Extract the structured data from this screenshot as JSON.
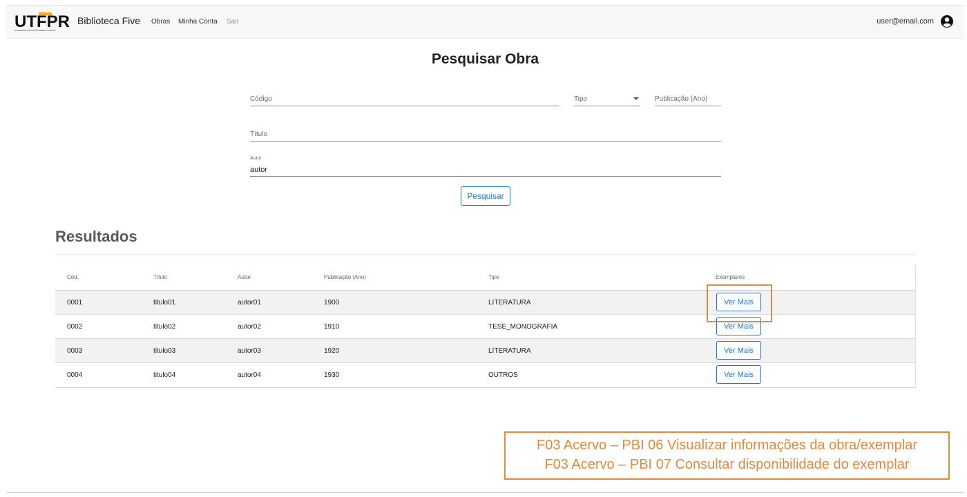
{
  "navbar": {
    "logo_text": "UTFPR",
    "logo_subtitle": "UNIVERSIDADE TECNOLÓGICA FEDERAL DO PARANÁ",
    "brand": "Biblioteca Five",
    "links": [
      {
        "label": "Obras"
      },
      {
        "label": "Minha Conta"
      },
      {
        "label": "Sair"
      }
    ],
    "user_email": "user@email.com",
    "user_icon": "account-circle-icon"
  },
  "search": {
    "title": "Pesquisar Obra",
    "fields": {
      "codigo": {
        "label": "Código",
        "value": ""
      },
      "tipo": {
        "label": "Tipo",
        "value": ""
      },
      "publicacao": {
        "label": "Publicação (Ano)",
        "value": ""
      },
      "titulo": {
        "label": "Título",
        "value": ""
      },
      "autor": {
        "label": "Autor",
        "value": "autor"
      }
    },
    "submit_label": "Pesquisar"
  },
  "results": {
    "title": "Resultados",
    "columns": [
      "Cód.",
      "Título",
      "Autor",
      "Publicação (Ano)",
      "Tipo",
      "Exemplares"
    ],
    "rows": [
      {
        "codigo": "0001",
        "titulo": "titulo01",
        "autor": "autor01",
        "ano": "1900",
        "tipo": "LITERATURA",
        "action": "Ver Mais"
      },
      {
        "codigo": "0002",
        "titulo": "titulo02",
        "autor": "autor02",
        "ano": "1910",
        "tipo": "TESE_MONOGRAFIA",
        "action": "Ver Mais"
      },
      {
        "codigo": "0003",
        "titulo": "titulo03",
        "autor": "autor03",
        "ano": "1920",
        "tipo": "LITERATURA",
        "action": "Ver Mais"
      },
      {
        "codigo": "0004",
        "titulo": "titulo04",
        "autor": "autor04",
        "ano": "1930",
        "tipo": "OUTROS",
        "action": "Ver Mais"
      }
    ]
  },
  "annotation": {
    "lines": [
      "F03 Acervo – PBI 06 Visualizar informações da obra/exemplar",
      "F03 Acervo – PBI 07 Consultar disponibilidade do exemplar"
    ]
  },
  "colors": {
    "accent": "#1976d2",
    "annotation": "#e08a3c",
    "logo_orange": "#f5a623"
  }
}
